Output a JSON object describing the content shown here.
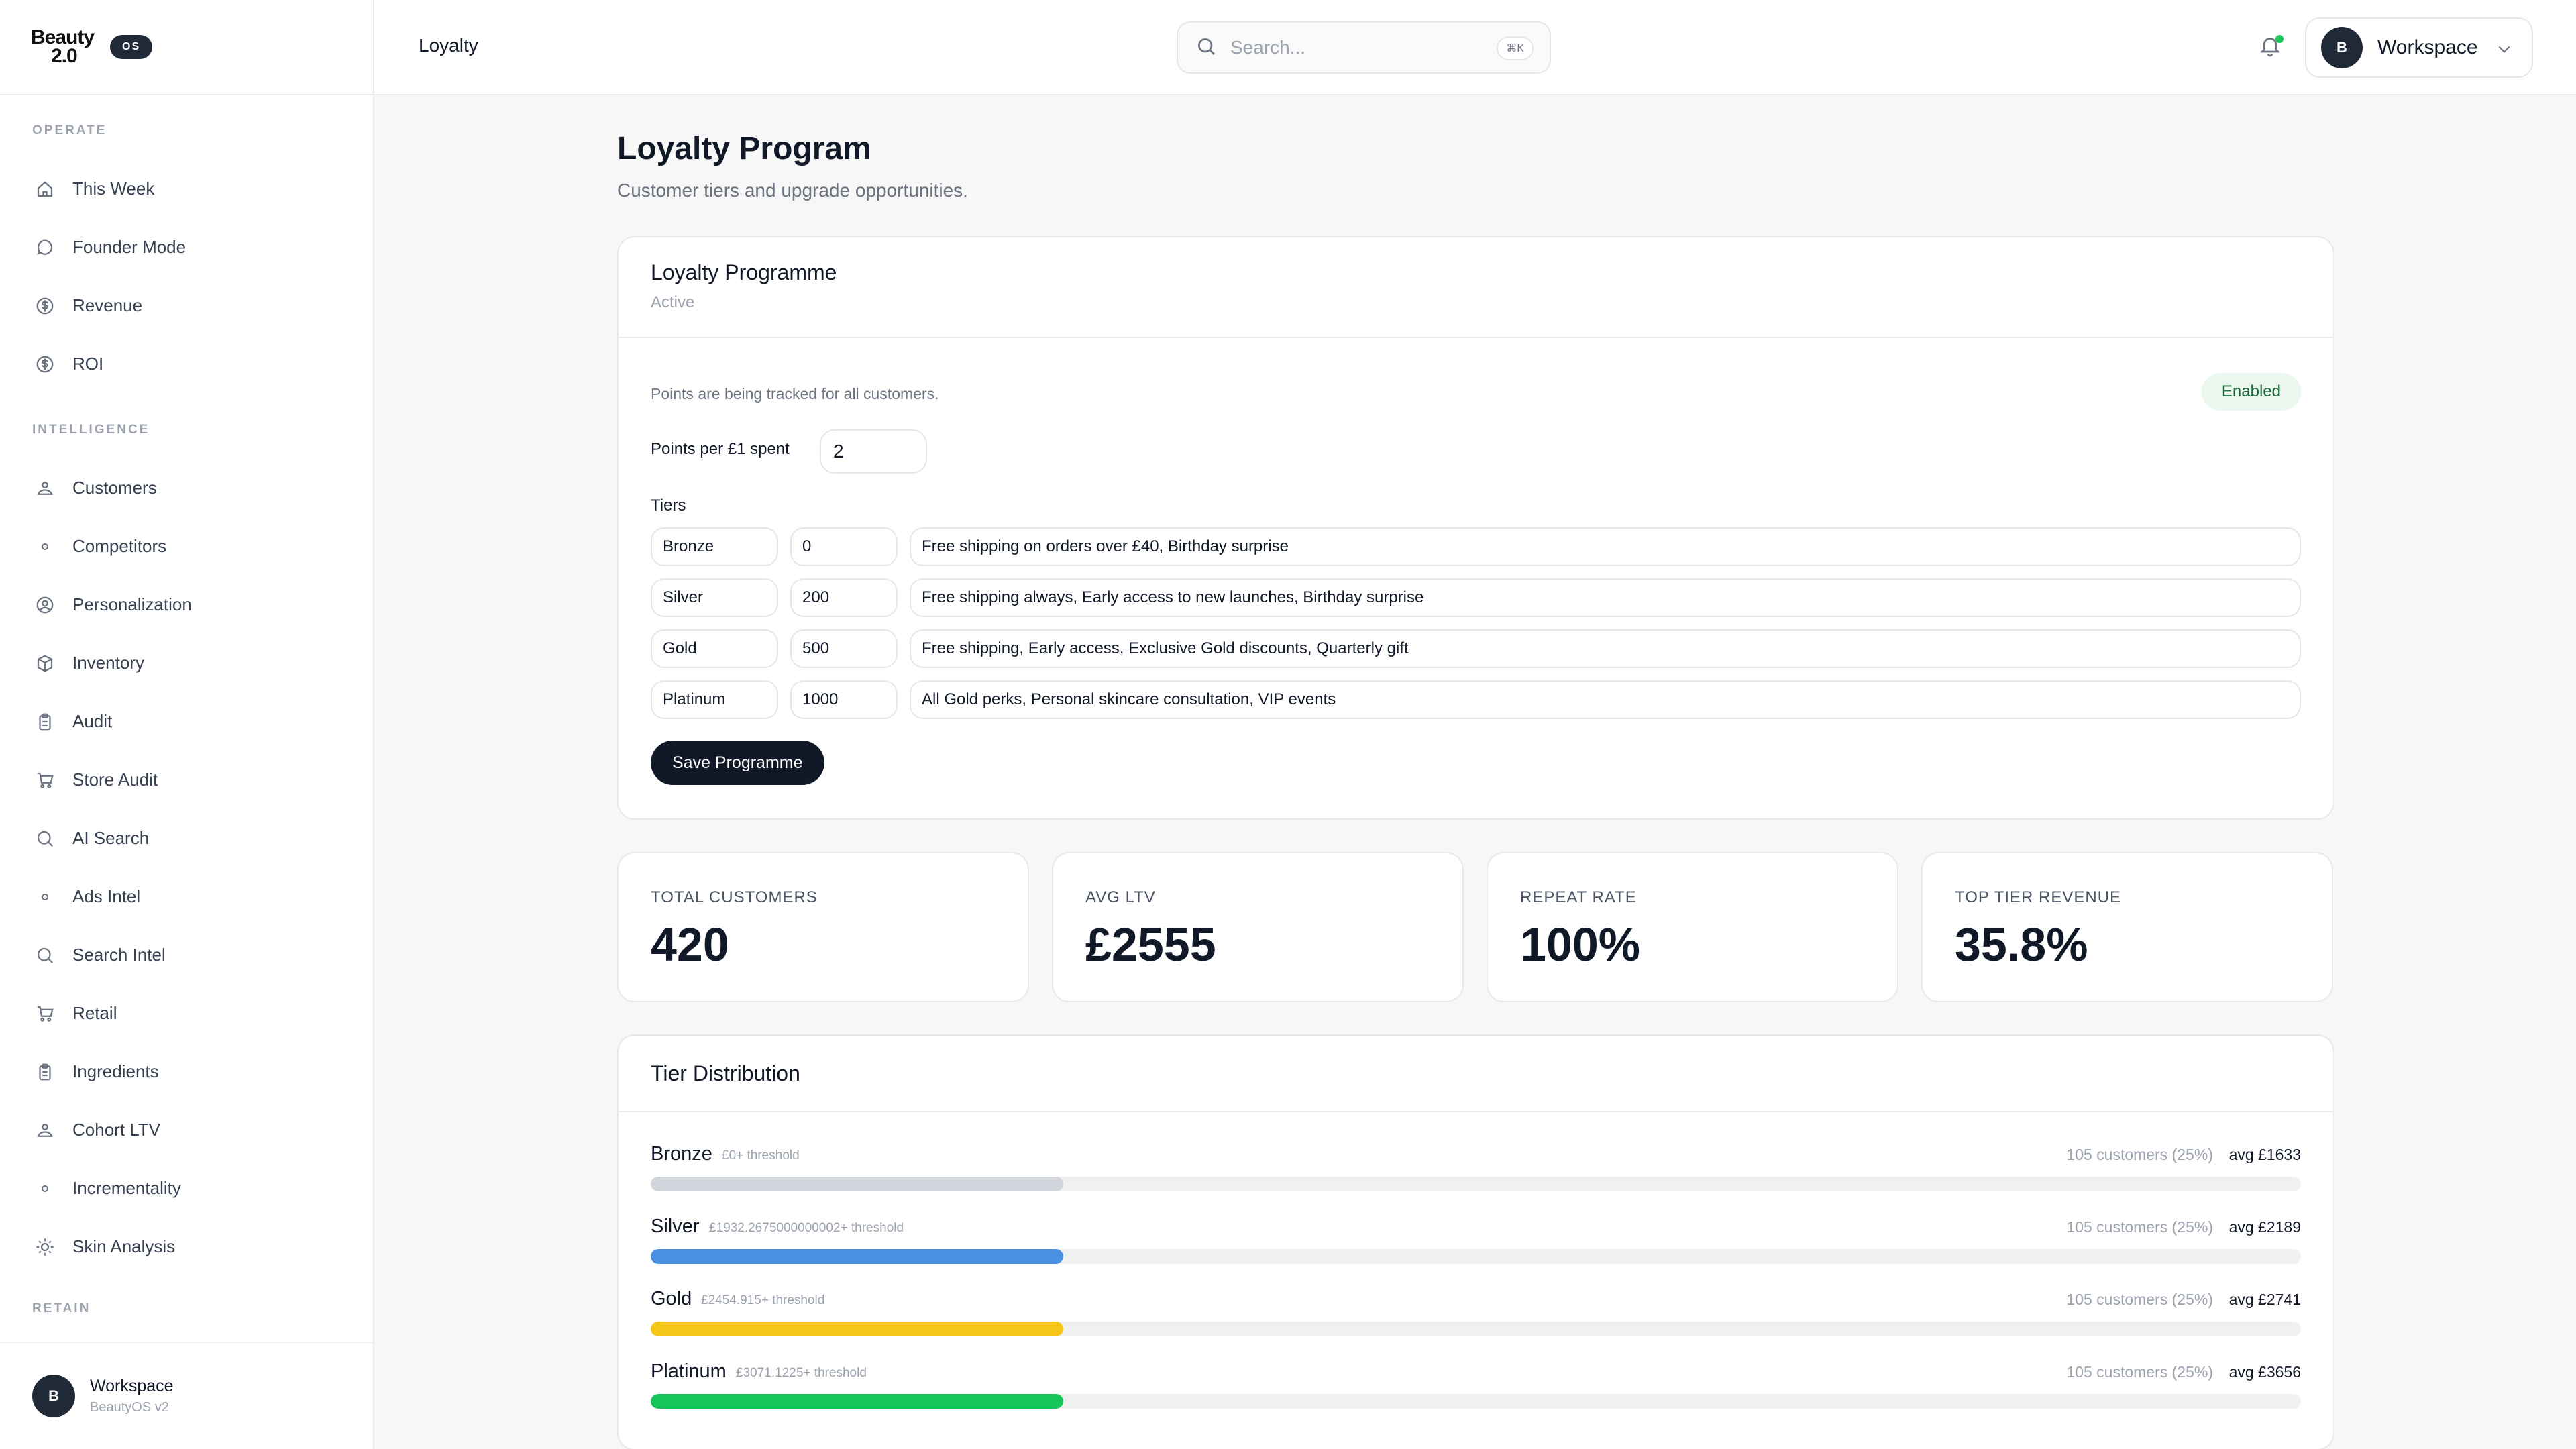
{
  "brand": {
    "logo_line1": "Beauty",
    "logo_line2": "2.0",
    "badge": "OS"
  },
  "sidebar": {
    "sections": [
      {
        "title": "OPERATE",
        "items": [
          {
            "label": "This Week",
            "icon": "home-icon"
          },
          {
            "label": "Founder Mode",
            "icon": "chat-icon"
          },
          {
            "label": "Revenue",
            "icon": "dollar-icon"
          },
          {
            "label": "ROI",
            "icon": "dollar-icon"
          }
        ]
      },
      {
        "title": "INTELLIGENCE",
        "items": [
          {
            "label": "Customers",
            "icon": "users-icon"
          },
          {
            "label": "Competitors",
            "icon": "dot-icon"
          },
          {
            "label": "Personalization",
            "icon": "user-circle-icon"
          },
          {
            "label": "Inventory",
            "icon": "box-icon"
          },
          {
            "label": "Audit",
            "icon": "clipboard-icon"
          },
          {
            "label": "Store Audit",
            "icon": "cart-icon"
          },
          {
            "label": "AI Search",
            "icon": "search-icon"
          },
          {
            "label": "Ads Intel",
            "icon": "dot-icon"
          },
          {
            "label": "Search Intel",
            "icon": "search-icon"
          },
          {
            "label": "Retail",
            "icon": "cart-icon"
          },
          {
            "label": "Ingredients",
            "icon": "clipboard-icon"
          },
          {
            "label": "Cohort LTV",
            "icon": "users-icon"
          },
          {
            "label": "Incrementality",
            "icon": "dot-icon"
          },
          {
            "label": "Skin Analysis",
            "icon": "sun-icon"
          }
        ]
      },
      {
        "title": "RETAIN",
        "items": []
      }
    ],
    "footer": {
      "avatar": "B",
      "name": "Workspace",
      "sub": "BeautyOS v2"
    }
  },
  "header": {
    "title": "Loyalty",
    "search_placeholder": "Search...",
    "search_kbd": "⌘K",
    "workspace": {
      "avatar": "B",
      "label": "Workspace"
    }
  },
  "page": {
    "title": "Loyalty Program",
    "subtitle": "Customer tiers and upgrade opportunities."
  },
  "programme": {
    "title": "Loyalty Programme",
    "status": "Active",
    "tracked_text": "Points are being tracked for all customers.",
    "badge": "Enabled",
    "points_label": "Points per £1 spent",
    "points_value": "2",
    "tiers_label": "Tiers",
    "tiers": [
      {
        "name": "Bronze",
        "threshold": "0",
        "perks": "Free shipping on orders over £40, Birthday surprise"
      },
      {
        "name": "Silver",
        "threshold": "200",
        "perks": "Free shipping always, Early access to new launches, Birthday surprise"
      },
      {
        "name": "Gold",
        "threshold": "500",
        "perks": "Free shipping, Early access, Exclusive Gold discounts, Quarterly gift"
      },
      {
        "name": "Platinum",
        "threshold": "1000",
        "perks": "All Gold perks, Personal skincare consultation, VIP events"
      }
    ],
    "save_label": "Save Programme"
  },
  "stats": [
    {
      "label": "TOTAL CUSTOMERS",
      "value": "420"
    },
    {
      "label": "AVG LTV",
      "value": "£2555"
    },
    {
      "label": "REPEAT RATE",
      "value": "100%"
    },
    {
      "label": "TOP TIER REVENUE",
      "value": "35.8%"
    }
  ],
  "distribution": {
    "title": "Tier Distribution",
    "rows": [
      {
        "name": "Bronze",
        "threshold": "£0+ threshold",
        "count": "105 customers (25%)",
        "avg": "avg £1633",
        "share": 0.25,
        "color": "#d1d5db"
      },
      {
        "name": "Silver",
        "threshold": "£1932.2675000000002+ threshold",
        "count": "105 customers (25%)",
        "avg": "avg £2189",
        "share": 0.25,
        "color": "#4a90e2"
      },
      {
        "name": "Gold",
        "threshold": "£2454.915+ threshold",
        "count": "105 customers (25%)",
        "avg": "avg £2741",
        "share": 0.25,
        "color": "#f5c518"
      },
      {
        "name": "Platinum",
        "threshold": "£3071.1225+ threshold",
        "count": "105 customers (25%)",
        "avg": "avg £3656",
        "share": 0.25,
        "color": "#16c45a"
      }
    ]
  }
}
